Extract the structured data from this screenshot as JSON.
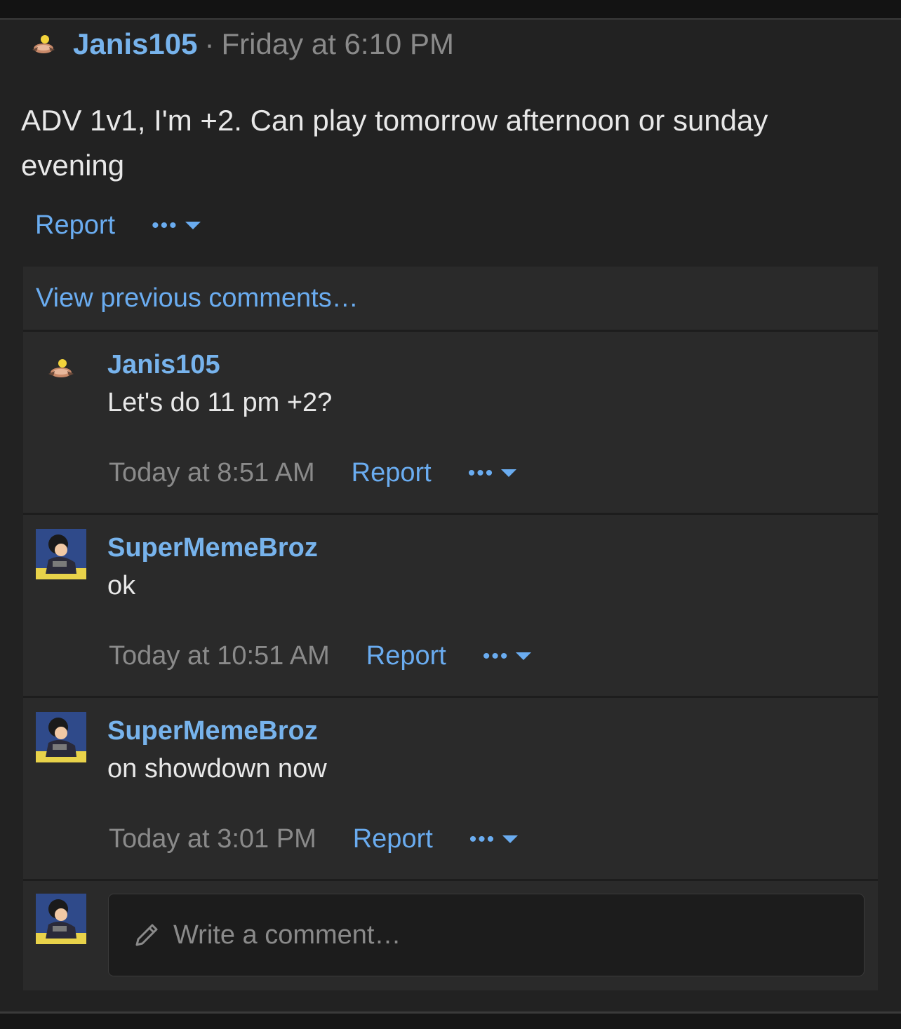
{
  "post": {
    "author": "Janis105",
    "separator": "·",
    "time": "Friday at 6:10 PM",
    "body": "ADV 1v1, I'm +2. Can play tomorrow afternoon or sunday evening",
    "report_label": "Report",
    "more_label": "•••"
  },
  "comments": {
    "view_previous": "View previous comments…",
    "items": [
      {
        "author": "Janis105",
        "text": "Let's do 11 pm +2?",
        "time": "Today at 8:51 AM",
        "report_label": "Report",
        "more_label": "•••"
      },
      {
        "author": "SuperMemeBroz",
        "text": "ok",
        "time": "Today at 10:51 AM",
        "report_label": "Report",
        "more_label": "•••"
      },
      {
        "author": "SuperMemeBroz",
        "text": "on showdown now",
        "time": "Today at 3:01 PM",
        "report_label": "Report",
        "more_label": "•••"
      }
    ]
  },
  "composer": {
    "placeholder": "Write a comment…"
  },
  "colors": {
    "link": "#6aacf0",
    "username": "#77b3ec",
    "muted": "#8a8a8a",
    "panel": "#222222",
    "comment_bg": "#2a2a2a"
  },
  "icons": {
    "janis_avatar": "pokemon-sprite-avatar",
    "supermemebroz_avatar": "anime-character-avatar",
    "pencil": "pencil-icon",
    "caret": "caret-down-icon"
  }
}
